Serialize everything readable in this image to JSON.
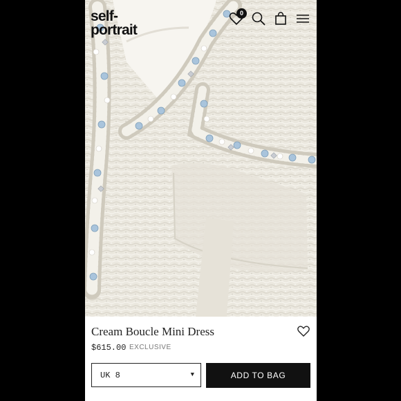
{
  "brand": {
    "line1": "self-",
    "line2": "portrait"
  },
  "header": {
    "cart_count": "0",
    "icons": [
      "wishlist-icon",
      "search-icon",
      "bag-icon",
      "menu-icon"
    ]
  },
  "product": {
    "name": "Cream Boucle Mini Dress",
    "price": "$615.00",
    "tag": "EXCLUSIVE"
  },
  "size_select": {
    "value": "UK 8"
  },
  "actions": {
    "add_to_bag_label": "ADD TO BAG"
  },
  "colors": {
    "fabric": "#ece9e0",
    "trim_stones": "#a9c4dc",
    "black": "#111111"
  }
}
